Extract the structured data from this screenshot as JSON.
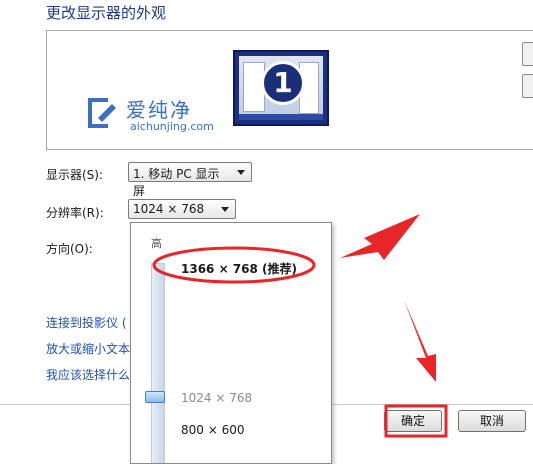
{
  "page": {
    "title": "更改显示器的外观"
  },
  "preview": {
    "monitor_number": "1"
  },
  "watermark": {
    "brand": "爱纯净",
    "url": "aichunjing.com"
  },
  "settings": {
    "display": {
      "label": "显示器(S):",
      "value": "1. 移动 PC 显示屏"
    },
    "resolution": {
      "label": "分辨率(R):",
      "value": "1024 × 768"
    },
    "orientation": {
      "label": "方向(O):"
    }
  },
  "links": [
    "连接到投影仪 (",
    "放大或缩小文本",
    "我应该选择什么"
  ],
  "resolution_dropdown": {
    "high_label": "高",
    "options": [
      "1366 × 768 (推荐)",
      "1024 × 768",
      "800 × 600"
    ],
    "recommended_index": 0,
    "selected_index": 1
  },
  "buttons": {
    "ok": "确定",
    "cancel": "取消"
  },
  "colors": {
    "annotation_red": "#e8262a",
    "link_blue": "#1e50b8"
  }
}
